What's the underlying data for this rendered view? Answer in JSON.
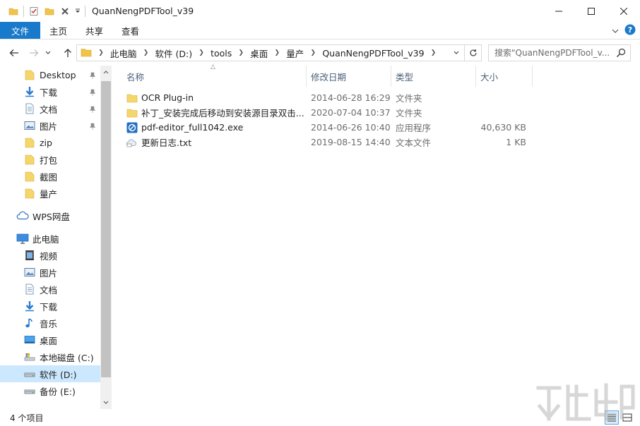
{
  "window": {
    "title": "QuanNengPDFTool_v39"
  },
  "ribbon": {
    "tabs": [
      {
        "label": "文件",
        "active": true
      },
      {
        "label": "主页",
        "active": false
      },
      {
        "label": "共享",
        "active": false
      },
      {
        "label": "查看",
        "active": false
      }
    ],
    "accent_color": "#1979ca"
  },
  "address": {
    "breadcrumbs": [
      "此电脑",
      "软件 (D:)",
      "tools",
      "桌面",
      "量产",
      "QuanNengPDFTool_v39"
    ]
  },
  "search": {
    "placeholder": "搜索\"QuanNengPDFTool_v..."
  },
  "sidebar": {
    "quick_access": [
      {
        "label": "Desktop",
        "icon": "folder-icon",
        "pinned": true
      },
      {
        "label": "下载",
        "icon": "download-icon",
        "pinned": true
      },
      {
        "label": "文档",
        "icon": "document-icon",
        "pinned": true
      },
      {
        "label": "图片",
        "icon": "picture-icon",
        "pinned": true
      },
      {
        "label": "zip",
        "icon": "folder-icon",
        "pinned": false
      },
      {
        "label": "打包",
        "icon": "folder-icon",
        "pinned": false
      },
      {
        "label": "截图",
        "icon": "folder-icon",
        "pinned": false
      },
      {
        "label": "量产",
        "icon": "folder-icon",
        "pinned": false
      }
    ],
    "wps": {
      "label": "WPS网盘",
      "icon": "cloud-icon"
    },
    "this_pc": {
      "label": "此电脑",
      "icon": "computer-icon"
    },
    "pc_items": [
      {
        "label": "视频",
        "icon": "video-icon",
        "selected": false
      },
      {
        "label": "图片",
        "icon": "picture-icon",
        "selected": false
      },
      {
        "label": "文档",
        "icon": "document-icon",
        "selected": false
      },
      {
        "label": "下载",
        "icon": "download-icon",
        "selected": false
      },
      {
        "label": "音乐",
        "icon": "music-icon",
        "selected": false
      },
      {
        "label": "桌面",
        "icon": "desktop-icon",
        "selected": false
      },
      {
        "label": "本地磁盘 (C:)",
        "icon": "system-drive-icon",
        "selected": false
      },
      {
        "label": "软件 (D:)",
        "icon": "drive-icon",
        "selected": true
      },
      {
        "label": "备份 (E:)",
        "icon": "drive-icon",
        "selected": false
      }
    ]
  },
  "columns": {
    "name": "名称",
    "date": "修改日期",
    "type": "类型",
    "size": "大小"
  },
  "files": [
    {
      "name": "OCR Plug-in",
      "date": "2014-06-28 16:29",
      "type": "文件夹",
      "size": "",
      "icon": "folder-icon"
    },
    {
      "name": "补丁_安装完成后移动到安装源目录双击...",
      "date": "2020-07-04 10:37",
      "type": "文件夹",
      "size": "",
      "icon": "folder-icon"
    },
    {
      "name": "pdf-editor_full1042.exe",
      "date": "2014-06-26 10:40",
      "type": "应用程序",
      "size": "40,630 KB",
      "icon": "pdf-editor-app-icon"
    },
    {
      "name": "更新日志.txt",
      "date": "2019-08-15 14:40",
      "type": "文本文件",
      "size": "1 KB",
      "icon": "text-file-icon"
    }
  ],
  "status": {
    "item_count": "4 个项目"
  }
}
